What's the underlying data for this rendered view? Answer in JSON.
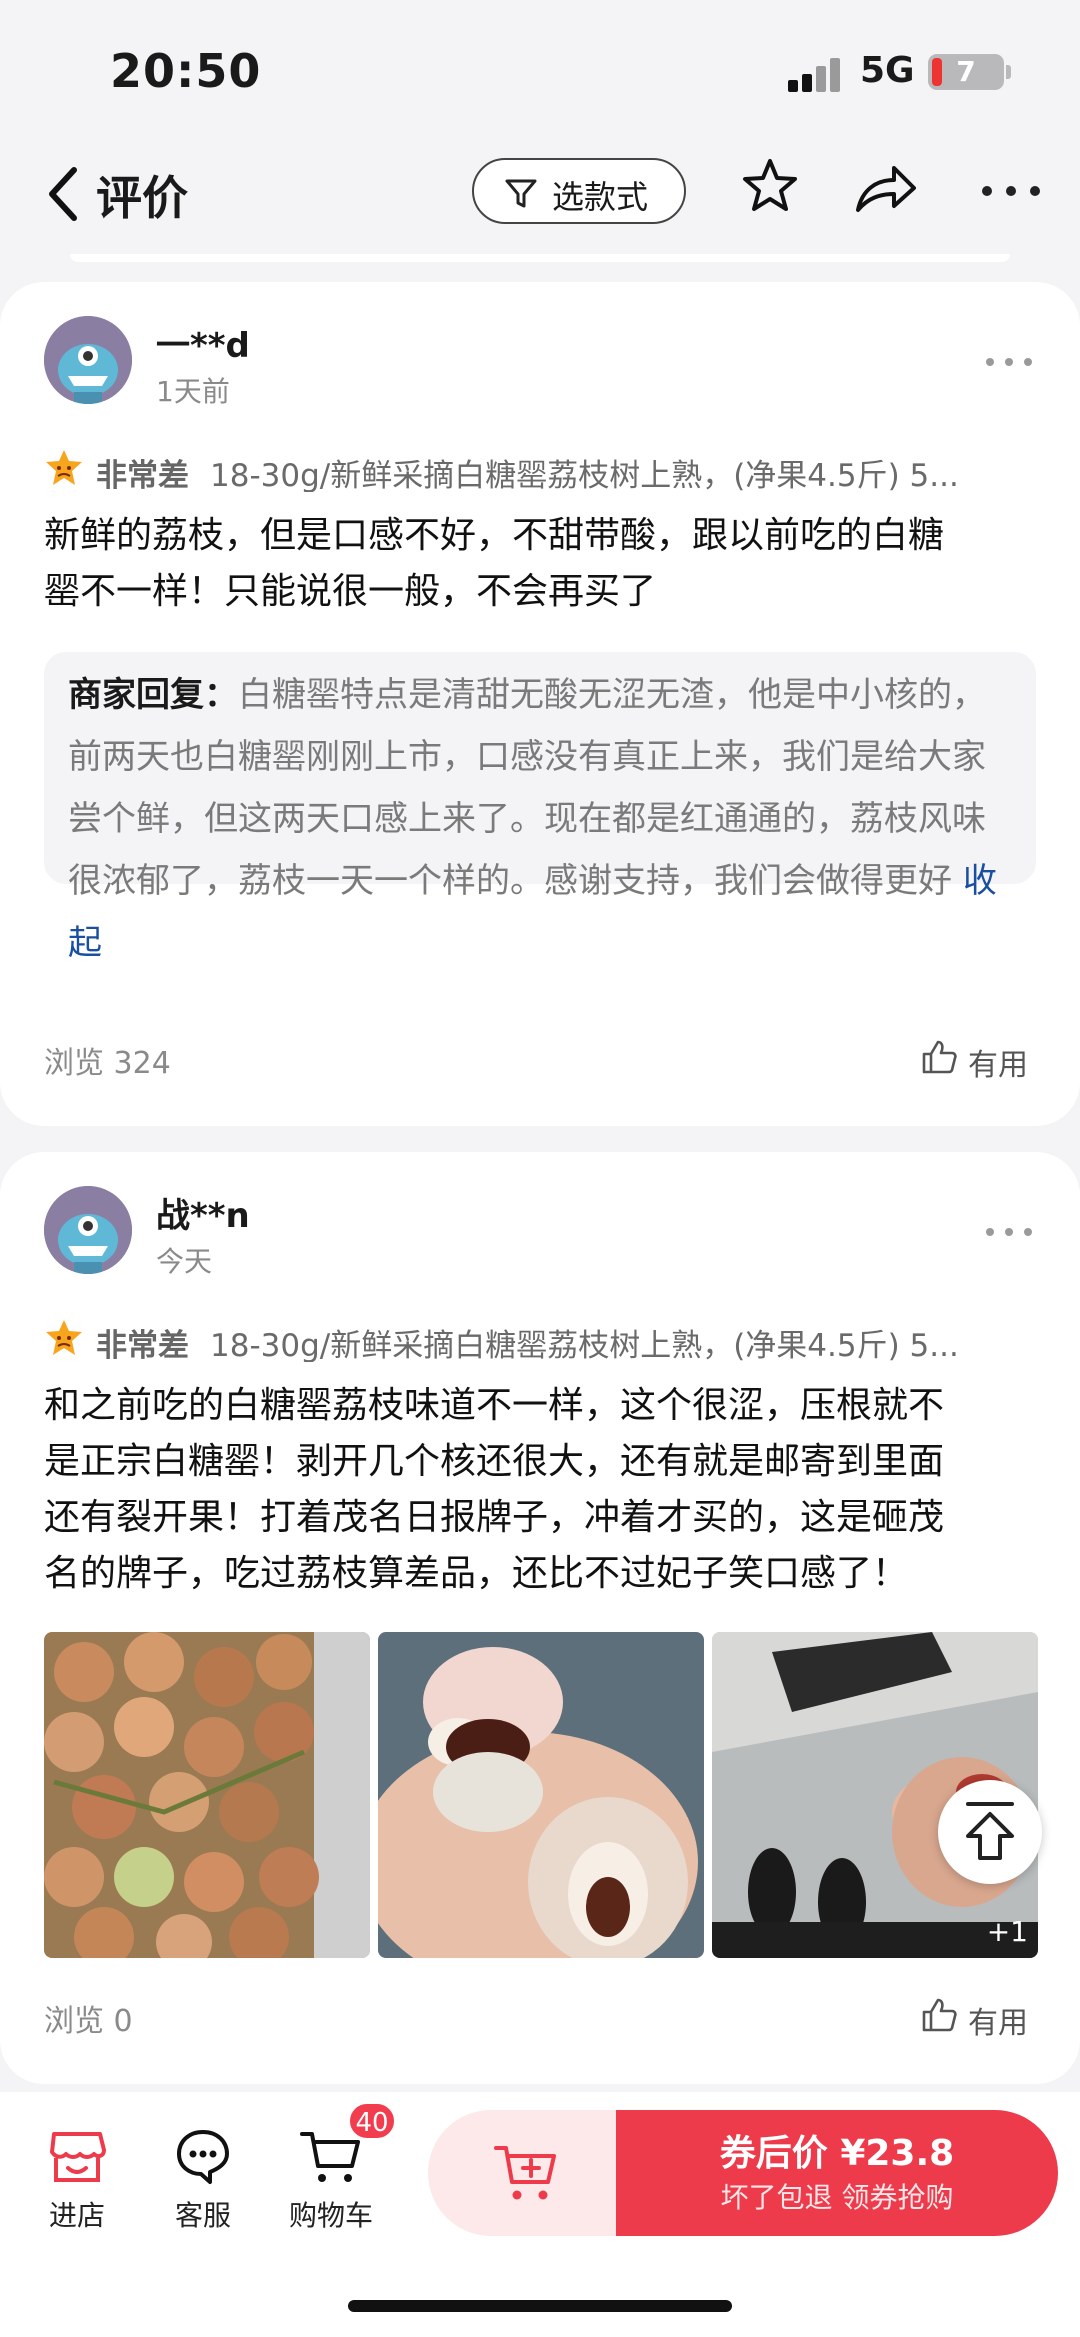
{
  "status_bar": {
    "time": "20:50",
    "network": "5G",
    "battery": "7"
  },
  "nav": {
    "title": "评价",
    "filter_label": "选款式"
  },
  "reviews": [
    {
      "username": "一**d",
      "time": "1天前",
      "rating": "非常差",
      "spec": "18-30g/新鲜采摘白糖罂荔枝树上熟，(净果4.5斤) 5...",
      "lines": [
        "新鲜的荔枝，但是口感不好，不甜带酸，跟以前吃的白糖",
        "罂不一样！只能说很一般，不会再买了"
      ],
      "reply_prefix": "商家回复：",
      "reply": "白糖罂特点是清甜无酸无涩无渣，他是中小核的，前两天也白糖罂刚刚上市，口感没有真正上来，我们是给大家尝个鲜，但这两天口感上来了。现在都是红通通的，荔枝风味很浓郁了，荔枝一天一个样的。感谢支持，我们会做得更好",
      "reply_toggle": "收起",
      "views": "浏览 324",
      "useful": "有用"
    },
    {
      "username": "战**n",
      "time": "今天",
      "rating": "非常差",
      "spec": "18-30g/新鲜采摘白糖罂荔枝树上熟，(净果4.5斤) 5...",
      "lines": [
        "和之前吃的白糖罂荔枝味道不一样，这个很涩，压根就不",
        "是正宗白糖罂！剥开几个核还很大，还有就是邮寄到里面",
        "还有裂开果！打着茂名日报牌子，冲着才买的，这是砸茂",
        "名的牌子，吃过荔枝算差品，还比不过妃子笑口感了！"
      ],
      "photo_more": "+1",
      "views": "浏览 0",
      "useful": "有用"
    }
  ],
  "bottom_bar": {
    "store": "进店",
    "service": "客服",
    "cart": "购物车",
    "cart_count": "40",
    "buy_price": "券后价 ¥23.8",
    "buy_sub": "坏了包退  领券抢购"
  },
  "colors": {
    "accent": "#ee3b4c",
    "link": "#1a4fa0",
    "background": "#f4f4f6"
  },
  "icons": [
    "back-icon",
    "filter-icon",
    "star-icon",
    "share-icon",
    "more-icon",
    "thumb-up-icon",
    "back-to-top-icon",
    "store-icon",
    "service-icon",
    "cart-icon",
    "add-cart-icon"
  ]
}
